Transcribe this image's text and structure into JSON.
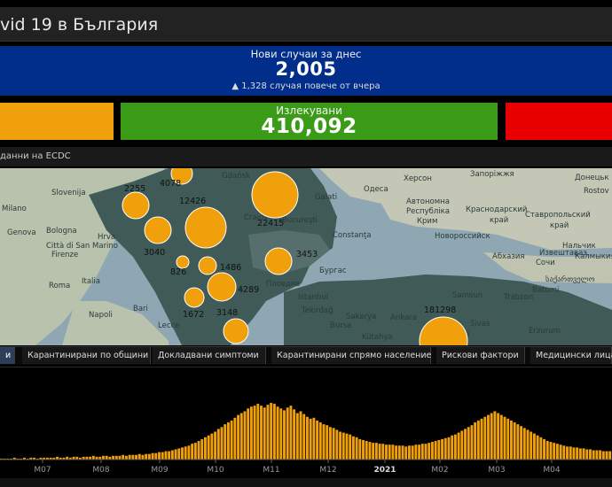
{
  "title": "vid 19 в България",
  "new_cases": {
    "label": "Нови случаи за днес",
    "value": "2,005",
    "delta": "▲ 1,328 случая повече от вчера"
  },
  "recovered": {
    "label": "Излекувани",
    "value": "410,092"
  },
  "map": {
    "source_label": "данни на ECDC",
    "places": [
      {
        "name": "Slovenija",
        "x": 58,
        "y": 22
      },
      {
        "name": "Milano",
        "x": 2,
        "y": 40
      },
      {
        "name": "Hrva",
        "x": 110,
        "y": 72
      },
      {
        "name": "Genova",
        "x": 8,
        "y": 67
      },
      {
        "name": "Bologna",
        "x": 52,
        "y": 65
      },
      {
        "name": "Città di San Marino",
        "x": 52,
        "y": 82
      },
      {
        "name": "Firenze",
        "x": 58,
        "y": 92
      },
      {
        "name": "Italia",
        "x": 92,
        "y": 122
      },
      {
        "name": "Roma",
        "x": 55,
        "y": 127
      },
      {
        "name": "Napoli",
        "x": 100,
        "y": 160
      },
      {
        "name": "Bari",
        "x": 150,
        "y": 153
      },
      {
        "name": "Lecce",
        "x": 178,
        "y": 172
      },
      {
        "name": "Gdańsk",
        "x": 250,
        "y": 3
      },
      {
        "name": "Craiov",
        "x": 275,
        "y": 50
      },
      {
        "name": "Bucureşti",
        "x": 318,
        "y": 53
      },
      {
        "name": "Galati",
        "x": 355,
        "y": 27
      },
      {
        "name": "Constanţa",
        "x": 375,
        "y": 70
      },
      {
        "name": "Бургас",
        "x": 360,
        "y": 110
      },
      {
        "name": "Пловдив",
        "x": 300,
        "y": 125
      },
      {
        "name": "Istanbul",
        "x": 336,
        "y": 140
      },
      {
        "name": "Tekirdağ",
        "x": 340,
        "y": 155
      },
      {
        "name": "Bursa",
        "x": 372,
        "y": 172
      },
      {
        "name": "Sakarya",
        "x": 390,
        "y": 162
      },
      {
        "name": "Ankara",
        "x": 440,
        "y": 163
      },
      {
        "name": "Kütahya",
        "x": 408,
        "y": 185
      },
      {
        "name": "Kayseri",
        "x": 498,
        "y": 182
      },
      {
        "name": "Sivas",
        "x": 530,
        "y": 170
      },
      {
        "name": "Samsun",
        "x": 510,
        "y": 138
      },
      {
        "name": "Trabzon",
        "x": 568,
        "y": 140
      },
      {
        "name": "Erzurum",
        "x": 596,
        "y": 178
      },
      {
        "name": "Херсон",
        "x": 455,
        "y": 6
      },
      {
        "name": "Одеса",
        "x": 410,
        "y": 18
      },
      {
        "name": "Запоріжжя",
        "x": 530,
        "y": 1
      },
      {
        "name": "Донецьк",
        "x": 648,
        "y": 5
      },
      {
        "name": "Ставропольский",
        "x": 592,
        "y": 47
      },
      {
        "name": "край",
        "x": 620,
        "y": 59
      },
      {
        "name": "Краснодарский",
        "x": 525,
        "y": 41
      },
      {
        "name": "край",
        "x": 552,
        "y": 53
      },
      {
        "name": "Автономна",
        "x": 458,
        "y": 32
      },
      {
        "name": "Республіка",
        "x": 458,
        "y": 43
      },
      {
        "name": "Крим",
        "x": 470,
        "y": 54
      },
      {
        "name": "Новороссийск",
        "x": 490,
        "y": 71
      },
      {
        "name": "Нальчик",
        "x": 634,
        "y": 82
      },
      {
        "name": "Абхазия",
        "x": 555,
        "y": 94
      },
      {
        "name": "Извештаваэ",
        "x": 608,
        "y": 90
      },
      {
        "name": "Калмыкия",
        "x": 648,
        "y": 94
      },
      {
        "name": "Сочи",
        "x": 604,
        "y": 101
      },
      {
        "name": "საქართველო",
        "x": 615,
        "y": 120
      },
      {
        "name": "Batumi",
        "x": 600,
        "y": 132
      },
      {
        "name": "Rostov",
        "x": 658,
        "y": 20
      }
    ],
    "bubbles": [
      {
        "label": "2255",
        "x": 153,
        "y": 42,
        "r": 15
      },
      {
        "label": "4078",
        "x": 205,
        "y": 6,
        "r": 12
      },
      {
        "label": "12426",
        "x": 232,
        "y": 67,
        "r": 23
      },
      {
        "label": "22415",
        "x": 310,
        "y": 30,
        "r": 26
      },
      {
        "label": "3040",
        "x": 178,
        "y": 70,
        "r": 15
      },
      {
        "label": "3453",
        "x": 314,
        "y": 105,
        "r": 15
      },
      {
        "label": "826",
        "x": 206,
        "y": 106,
        "r": 7
      },
      {
        "label": "1486",
        "x": 234,
        "y": 110,
        "r": 10
      },
      {
        "label": "4289",
        "x": 250,
        "y": 134,
        "r": 16
      },
      {
        "label": "1672",
        "x": 219,
        "y": 146,
        "r": 11
      },
      {
        "label": "3148",
        "x": 266,
        "y": 184,
        "r": 14
      },
      {
        "label": "181298",
        "x": 500,
        "y": 195,
        "r": 27
      }
    ],
    "bubble_labels": [
      {
        "text": "2255",
        "x": 140,
        "y": 26
      },
      {
        "text": "4078",
        "x": 180,
        "y": 20
      },
      {
        "text": "12426",
        "x": 202,
        "y": 40
      },
      {
        "text": "22415",
        "x": 290,
        "y": 65
      },
      {
        "text": "3040",
        "x": 162,
        "y": 98
      },
      {
        "text": "3453",
        "x": 334,
        "y": 100
      },
      {
        "text": "826",
        "x": 192,
        "y": 120
      },
      {
        "text": "1486",
        "x": 248,
        "y": 115
      },
      {
        "text": "4289",
        "x": 268,
        "y": 140
      },
      {
        "text": "1672",
        "x": 206,
        "y": 168
      },
      {
        "text": "3148",
        "x": 244,
        "y": 166
      },
      {
        "text": "181298",
        "x": 478,
        "y": 163
      }
    ]
  },
  "tabs": [
    {
      "label": "и",
      "active": true
    },
    {
      "label": "Карантинирани по общини",
      "active": false
    },
    {
      "label": "Докладвани симптоми",
      "active": false
    },
    {
      "label": "Карантинирани спрямо население",
      "active": false
    },
    {
      "label": "Рискови фактори",
      "active": false
    },
    {
      "label": "Медицински лица",
      "active": false
    }
  ],
  "chart_data": {
    "type": "bar",
    "title": "",
    "xlabel": "",
    "ylabel": "",
    "x_ticks": [
      "M07",
      "M08",
      "M09",
      "M10",
      "M11",
      "M12",
      "2021",
      "M02",
      "M03",
      "M04"
    ],
    "bar_color": "#f0a00a",
    "values": [
      1,
      1,
      1,
      1,
      2,
      1,
      1,
      2,
      1,
      2,
      2,
      1,
      2,
      2,
      2,
      2,
      2,
      3,
      2,
      2,
      3,
      2,
      3,
      3,
      2,
      3,
      3,
      3,
      4,
      3,
      3,
      4,
      4,
      3,
      4,
      4,
      4,
      5,
      4,
      5,
      5,
      5,
      6,
      5,
      6,
      6,
      7,
      7,
      8,
      8,
      9,
      9,
      10,
      11,
      12,
      13,
      14,
      15,
      17,
      18,
      20,
      22,
      24,
      26,
      28,
      30,
      33,
      35,
      38,
      40,
      42,
      45,
      48,
      50,
      52,
      55,
      57,
      58,
      60,
      58,
      56,
      59,
      61,
      60,
      57,
      55,
      53,
      56,
      58,
      54,
      50,
      52,
      49,
      46,
      44,
      45,
      42,
      40,
      38,
      37,
      35,
      34,
      32,
      30,
      29,
      28,
      27,
      25,
      24,
      22,
      21,
      20,
      19,
      18,
      18,
      17,
      17,
      16,
      16,
      16,
      15,
      15,
      15,
      14,
      15,
      15,
      16,
      16,
      17,
      17,
      18,
      19,
      20,
      21,
      22,
      23,
      24,
      26,
      27,
      29,
      31,
      33,
      35,
      37,
      40,
      42,
      44,
      46,
      48,
      50,
      52,
      50,
      48,
      46,
      44,
      42,
      40,
      38,
      36,
      34,
      32,
      30,
      28,
      26,
      24,
      22,
      20,
      19,
      18,
      17,
      16,
      15,
      14,
      14,
      13,
      13,
      12,
      12,
      11,
      11,
      10,
      10,
      10,
      9,
      9,
      9
    ]
  }
}
